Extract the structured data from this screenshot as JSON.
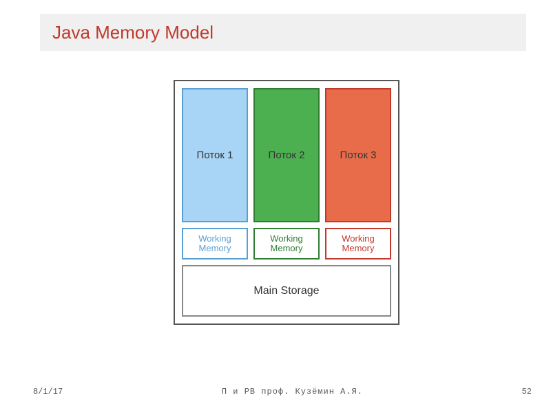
{
  "title": "Java Memory Model",
  "diagram": {
    "threads": [
      {
        "label": "Поток 1"
      },
      {
        "label": "Поток 2"
      },
      {
        "label": "Поток 3"
      }
    ],
    "working_memory": [
      {
        "line1": "Working",
        "line2": "Memory"
      },
      {
        "line1": "Working",
        "line2": "Memory"
      },
      {
        "line1": "Working",
        "line2": "Memory"
      }
    ],
    "main_storage": "Main Storage"
  },
  "footer": {
    "date": "8/1/17",
    "center": "П и РВ  проф. Кузёмин А.Я.",
    "page": "52"
  }
}
